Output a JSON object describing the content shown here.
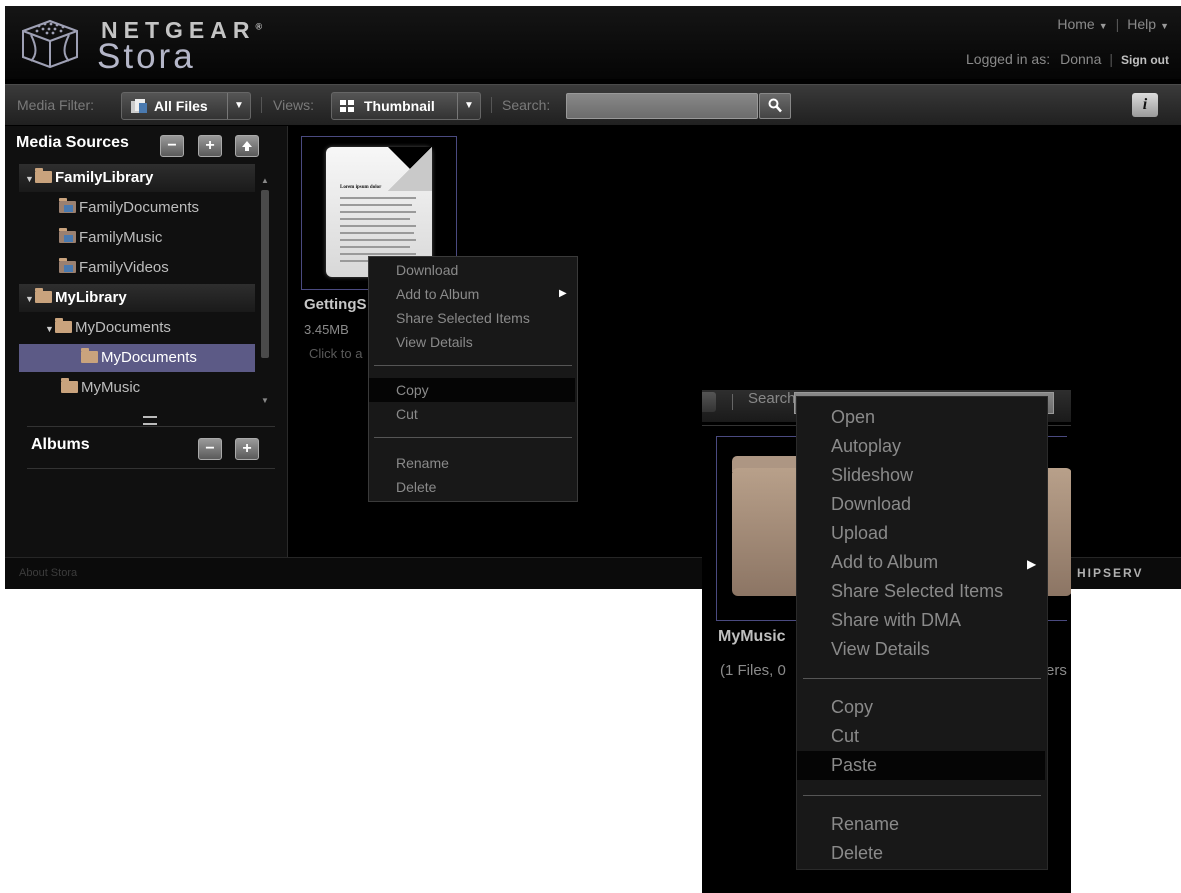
{
  "header": {
    "logo_netgear": "NETGEAR",
    "logo_registered": "®",
    "logo_stora": "Stora",
    "home_link": "Home",
    "help_link": "Help",
    "logged_in_label": "Logged in as:",
    "logged_in_user": "Donna",
    "sign_out": "Sign out"
  },
  "toolbar": {
    "media_filter_label": "Media Filter:",
    "media_filter_value": "All Files",
    "views_label": "Views:",
    "views_value": "Thumbnail",
    "search_label": "Search:",
    "info_button": "i"
  },
  "sidebar": {
    "media_sources_title": "Media Sources",
    "albums_title": "Albums",
    "tree": [
      {
        "label": "FamilyLibrary"
      },
      {
        "label": "FamilyDocuments"
      },
      {
        "label": "FamilyMusic"
      },
      {
        "label": "FamilyVideos"
      },
      {
        "label": "MyLibrary"
      },
      {
        "label": "MyDocuments"
      },
      {
        "label": "MyDocuments"
      },
      {
        "label": "MyMusic"
      }
    ]
  },
  "content": {
    "file_name": "GettingS",
    "file_size": "3.45MB",
    "file_hint": "Click to a",
    "doc_title": "Lorem ipsum dolor"
  },
  "footer": {
    "about": "About Stora"
  },
  "context_menu_file": {
    "items": [
      "Download",
      "Add to Album",
      "Share Selected Items",
      "View Details",
      "Copy",
      "Cut",
      "Rename",
      "Delete"
    ],
    "highlighted": "Copy"
  },
  "inset": {
    "search_label": "Search:",
    "folder_name": "MyMusic",
    "folder_meta": "(1 Files, 0",
    "folder_meta_tail": "ers",
    "brand_fragment": "HIPSERV",
    "context_menu": {
      "items": [
        "Open",
        "Autoplay",
        "Slideshow",
        "Download",
        "Upload",
        "Add to Album",
        "Share Selected Items",
        "Share with DMA",
        "View Details",
        "Copy",
        "Cut",
        "Paste",
        "Rename",
        "Delete"
      ],
      "highlighted": "Paste"
    }
  },
  "colors": {
    "background": "#000000",
    "selected_row": "#5c5a86",
    "folder": "#c9a37d",
    "thumb_border": "#4a4a80",
    "menu_text": "#8a8a8a"
  }
}
